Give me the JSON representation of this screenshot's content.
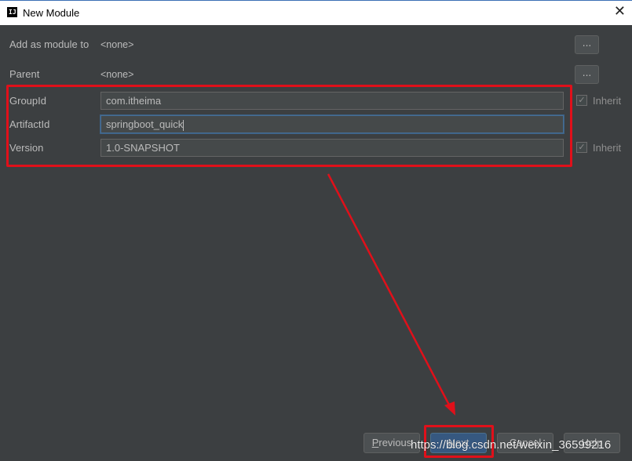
{
  "window": {
    "title": "New Module",
    "app_icon_text": "IJ",
    "close_glyph": "✕"
  },
  "form": {
    "add_as_module": {
      "label": "Add as module to",
      "value": "<none>",
      "button": "..."
    },
    "parent": {
      "label": "Parent",
      "value": "<none>",
      "button": "..."
    },
    "group_id": {
      "label": "GroupId",
      "value": "com.itheima",
      "inherit_label": "Inherit",
      "inherit_checked": true
    },
    "artifact_id": {
      "label": "ArtifactId",
      "value": "springboot_quick"
    },
    "version": {
      "label": "Version",
      "value": "1.0-SNAPSHOT",
      "inherit_label": "Inherit",
      "inherit_checked": true
    }
  },
  "buttons": {
    "previous": "Previous",
    "next": "Next",
    "cancel": "Cancel",
    "help": "Help"
  },
  "annotation": {
    "color": "#e0101a"
  },
  "watermark": "https://blog.csdn.net/weixin_36599216",
  "icons": {
    "app": "intellij-icon",
    "close": "close-icon",
    "check": "checkmark-icon"
  }
}
